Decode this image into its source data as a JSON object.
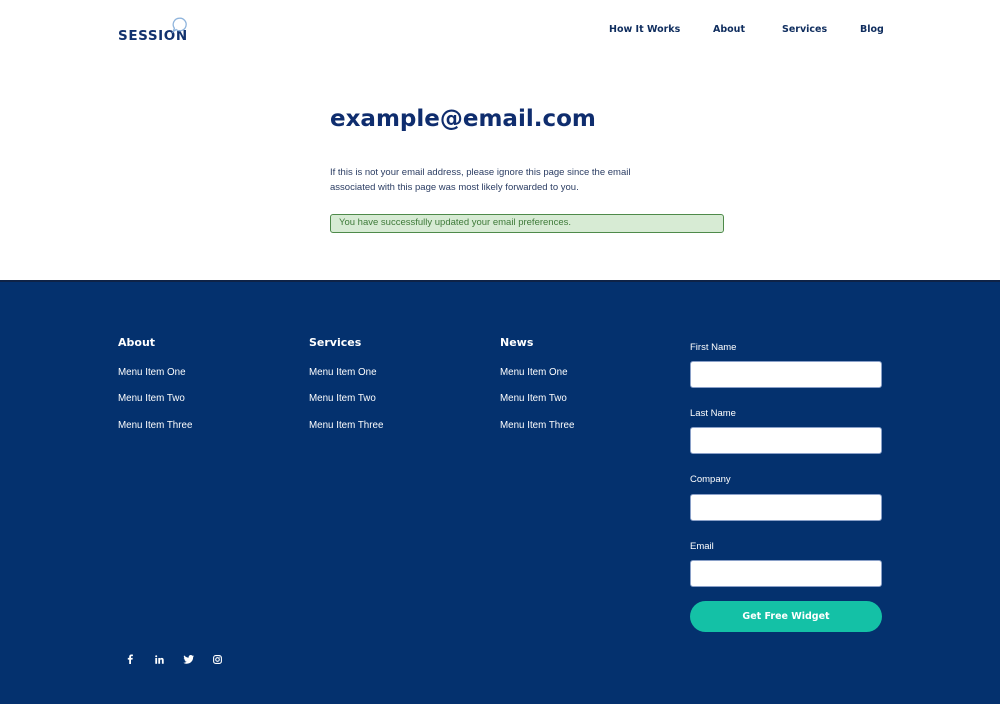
{
  "brand": {
    "name": "SESSION"
  },
  "nav": {
    "items": [
      {
        "label": "How It Works"
      },
      {
        "label": "About"
      },
      {
        "label": "Services"
      },
      {
        "label": "Blog"
      }
    ]
  },
  "main": {
    "email": "example@email.com",
    "notice": "If this is not your email address, please ignore this page since the email associated with this page was most likely forwarded to you.",
    "success_message": "You have successfully updated your email preferences."
  },
  "footer": {
    "columns": [
      {
        "title": "About",
        "links": [
          "Menu Item One",
          "Menu Item Two",
          "Menu Item Three"
        ]
      },
      {
        "title": "Services",
        "links": [
          "Menu Item One",
          "Menu Item Two",
          "Menu Item Three"
        ]
      },
      {
        "title": "News",
        "links": [
          "Menu Item One",
          "Menu Item Two",
          "Menu Item Three"
        ]
      }
    ],
    "form": {
      "fields": [
        {
          "label": "First Name",
          "value": ""
        },
        {
          "label": "Last Name",
          "value": ""
        },
        {
          "label": "Company",
          "value": ""
        },
        {
          "label": "Email",
          "value": ""
        }
      ],
      "submit_label": "Get Free Widget"
    },
    "social": [
      "facebook-icon",
      "linkedin-icon",
      "twitter-icon",
      "instagram-icon"
    ]
  },
  "colors": {
    "primary_navy": "#04316e",
    "heading_navy": "#0f2d6e",
    "accent_teal": "#14c1a6",
    "success_bg": "#d7ebd4",
    "success_border": "#4e8a4a",
    "success_text": "#3e7a39"
  }
}
